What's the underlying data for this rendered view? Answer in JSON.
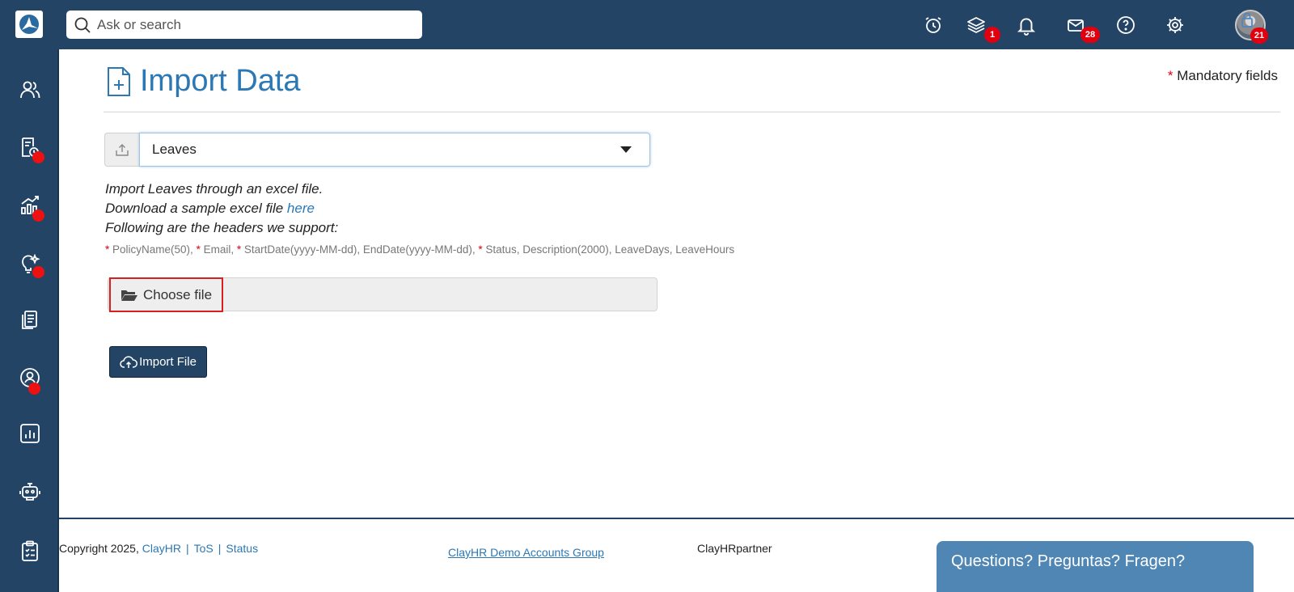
{
  "topbar": {
    "search_placeholder": "Ask or search",
    "layers_badge": "1",
    "mail_badge": "28",
    "lock_badge": "21",
    "icons": [
      "clock-icon",
      "layers-icon",
      "bell-icon",
      "mail-icon",
      "help-icon",
      "gear-icon",
      "avatar"
    ]
  },
  "sidebar": {
    "items": [
      "people-icon",
      "billing-icon",
      "growth-chart-icon",
      "ideas-icon",
      "documents-icon",
      "profile-icon",
      "report-icon",
      "robot-icon",
      "clipboard-icon"
    ]
  },
  "page": {
    "title": "Import Data",
    "mandatory_label": "Mandatory fields",
    "mandatory_star": "*"
  },
  "import": {
    "selected_type": "Leaves",
    "line1": "Import Leaves through an excel file.",
    "line2_prefix": "Download a sample excel file ",
    "line2_link": "here",
    "line3": "Following are the headers we support:",
    "headers": [
      {
        "star": "*",
        "text": " PolicyName(50), "
      },
      {
        "star": "*",
        "text": " Email, "
      },
      {
        "star": "*",
        "text": " StartDate(yyyy-MM-dd), EndDate(yyyy-MM-dd), "
      },
      {
        "star": "*",
        "text": " Status, Description(2000), LeaveDays, LeaveHours"
      }
    ],
    "choose_file_label": "Choose file",
    "import_button_label": "Import File"
  },
  "footer": {
    "copyright": "Copyright 2025, ",
    "company_link": "ClayHR",
    "tos_link": "ToS",
    "status_link": "Status",
    "separator": "|",
    "group_link": "ClayHR Demo Accounts Group",
    "partner": "ClayHRpartner",
    "help_widget": "Questions? Preguntas? Fragen?"
  },
  "colors": {
    "nav_bg": "#244466",
    "accent": "#2b78b4",
    "badge": "#e0000f"
  }
}
